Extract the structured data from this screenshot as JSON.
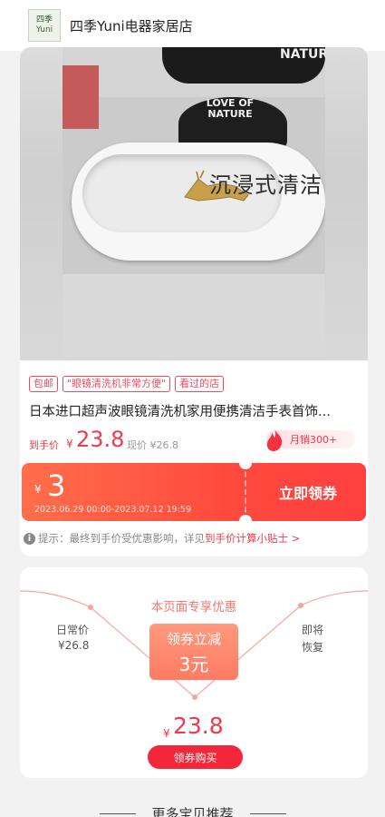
{
  "shop": {
    "name": "四季Yuni电器家居店",
    "logo_text": "四季 Yuni"
  },
  "media": {
    "overlay_text": "沉浸式清洁",
    "jar_text": "NATUR",
    "jar_label": "LOVE OF NATURE"
  },
  "product": {
    "tags": [
      "包邮",
      "\"眼镜清洗机非常方便\"",
      "看过的店"
    ],
    "title": "日本进口超声波眼镜清洗机家用便携清洁手表首饰...",
    "price_label": "到手价",
    "price_currency": "¥",
    "price": "23.8",
    "original_price": "现价 ¥26.8",
    "sales": "月销300+"
  },
  "coupon": {
    "currency": "¥",
    "amount": "3",
    "validity": "2023.06.29 00:00-2023.07.12 19:59",
    "button_label": "立即领券"
  },
  "tip": {
    "text": "提示：最终到手价受优惠影响，详见",
    "link": "到手价计算小贴士 >"
  },
  "offer": {
    "exclusive_label": "本页面专享优惠",
    "regular_label": "日常价",
    "regular_price": "¥26.8",
    "restore_line1": "即将",
    "restore_line2": "恢复",
    "discount_label": "领券立减",
    "discount_amount": "3元",
    "final_currency": "¥",
    "final_price": "23.8",
    "buy_button": "领券购买"
  },
  "recommend": {
    "title": "更多宝贝推荐"
  },
  "colors": {
    "accent": "#f03a4a",
    "coupon_start": "#ff6e4a",
    "coupon_end": "#ff3f3f"
  }
}
